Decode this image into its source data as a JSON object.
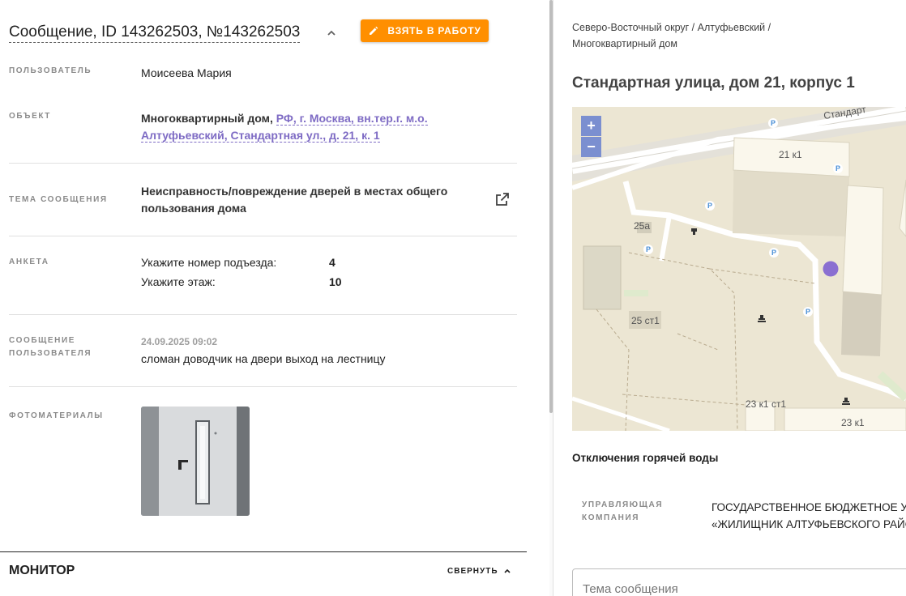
{
  "header": {
    "title": "Сообщение, ID 143262503, №143262503",
    "take_button": "ВЗЯТЬ В РАБОТУ"
  },
  "fields": {
    "user": {
      "label": "ПОЛЬЗОВАТЕЛЬ",
      "value": "Моисеева Мария"
    },
    "object": {
      "label": "ОБЪЕКТ",
      "type": "Многоквартирный дом,",
      "address_link": "РФ, г. Москва, вн.тер.г. м.о. Алтуфьевский, Стандартная ул., д. 21, к. 1"
    },
    "topic": {
      "label": "ТЕМА СООБЩЕНИЯ",
      "value": "Неисправность/повреждение дверей в местах общего пользования дома"
    },
    "form": {
      "label": "АНКЕТА",
      "rows": [
        {
          "question": "Укажите номер подъезда:",
          "answer": "4"
        },
        {
          "question": "Укажите этаж:",
          "answer": "10"
        }
      ]
    },
    "message": {
      "label": "СООБЩЕНИЕ ПОЛЬЗОВАТЕЛЯ",
      "date": "24.09.2025 09:02",
      "text": "сломан доводчик на двери выход на лестницу"
    },
    "photos": {
      "label": "ФОТОМАТЕРИАЛЫ"
    }
  },
  "monitor": {
    "title": "МОНИТОР",
    "collapse_label": "СВЕРНУТЬ"
  },
  "right": {
    "breadcrumb": "Северо-Восточный округ / Алтуфьевский / Многоквартирный дом",
    "address": "Стандартная улица, дом 21, корпус 1",
    "map": {
      "zoom_in": "+",
      "zoom_out": "−",
      "street_label": "Стандарт",
      "labels": [
        "21 к1",
        "25а",
        "25 ст1",
        "23 к1 ст1",
        "23 к1"
      ]
    },
    "hot_water_title": "Отключения горячей воды",
    "management": {
      "label": "УПРАВЛЯЮЩАЯ КОМПАНИЯ",
      "line1": "ГОСУДАРСТВЕННОЕ БЮДЖЕТНОЕ УЧ",
      "line2": "«ЖИЛИЩНИК АЛТУФЬЕВСКОГО РАЙО"
    },
    "topic_placeholder": "Тема сообщения"
  },
  "colors": {
    "accent": "#ff8f00",
    "link": "#7e6bc4",
    "map_marker": "#8a6fd1",
    "map_zoom": "#7b8fd0"
  }
}
